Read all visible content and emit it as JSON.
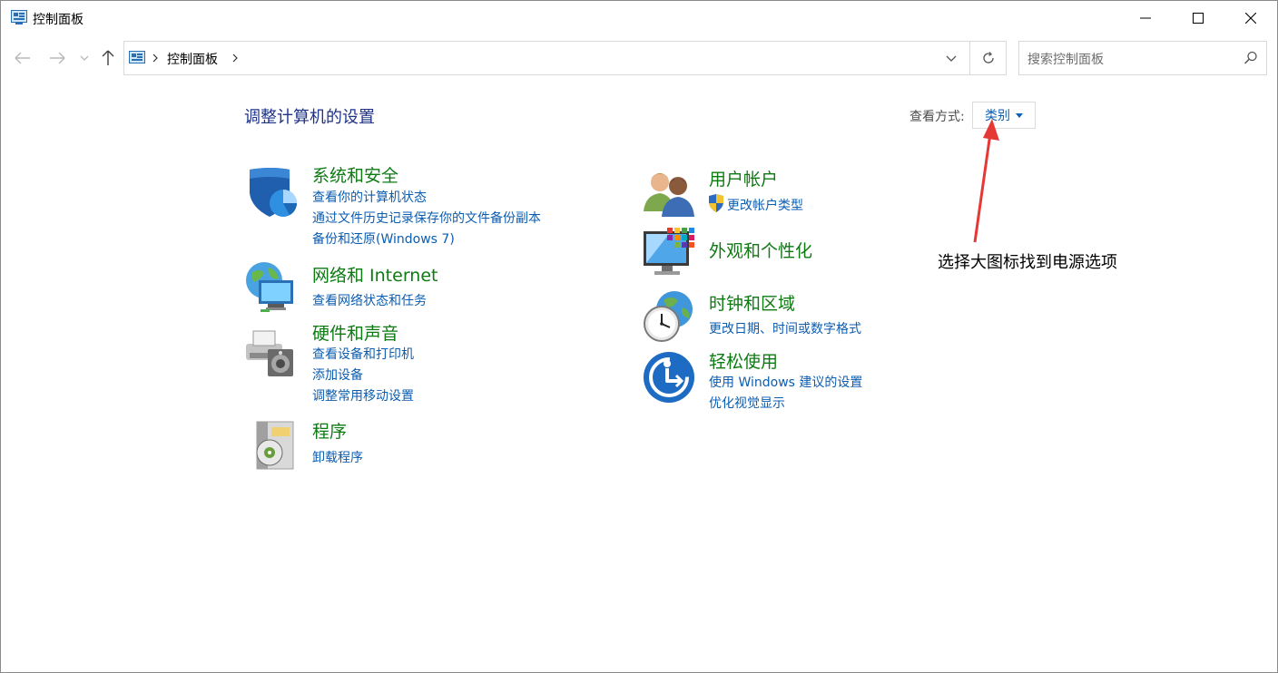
{
  "window": {
    "title": "控制面板",
    "controls": {
      "minimize": "minimize-icon",
      "maximize": "maximize-icon",
      "close": "close-icon"
    }
  },
  "nav": {
    "back": "back-arrow-icon",
    "forward": "forward-arrow-icon",
    "recent": "chevron-down-icon",
    "up": "up-arrow-icon"
  },
  "address": {
    "breadcrumb": "控制面板",
    "icons": [
      "control-panel-icon",
      "chevron-right-icon",
      "chevron-down-icon",
      "refresh-icon"
    ]
  },
  "search": {
    "placeholder": "搜索控制面板",
    "icon": "search-icon"
  },
  "main": {
    "title": "调整计算机的设置",
    "view_by": {
      "label": "查看方式:",
      "value": "类别"
    },
    "categories": [
      {
        "title": "系统和安全",
        "icon": "shield-icon",
        "links": [
          "查看你的计算机状态",
          "通过文件历史记录保存你的文件备份副本",
          "备份和还原(Windows 7)"
        ]
      },
      {
        "title": "网络和 Internet",
        "icon": "network-globe-icon",
        "links": [
          "查看网络状态和任务"
        ]
      },
      {
        "title": "硬件和声音",
        "icon": "printer-speaker-icon",
        "links": [
          "查看设备和打印机",
          "添加设备",
          "调整常用移动设置"
        ]
      },
      {
        "title": "程序",
        "icon": "programs-disc-icon",
        "links": [
          "卸载程序"
        ]
      },
      {
        "title": "用户帐户",
        "icon": "users-icon",
        "links": [
          "更改帐户类型"
        ]
      },
      {
        "title": "外观和个性化",
        "icon": "monitor-colors-icon",
        "links": []
      },
      {
        "title": "时钟和区域",
        "icon": "clock-globe-icon",
        "links": [
          "更改日期、时间或数字格式"
        ]
      },
      {
        "title": "轻松使用",
        "icon": "ease-of-access-icon",
        "links": [
          "使用 Windows 建议的设置",
          "优化视觉显示"
        ]
      }
    ]
  },
  "annotation": {
    "text": "选择大图标找到电源选项",
    "arrow_color": "#e53935"
  },
  "colors": {
    "category_title": "#0d7a12",
    "link": "#0c5db0",
    "page_title": "#1e3287"
  }
}
